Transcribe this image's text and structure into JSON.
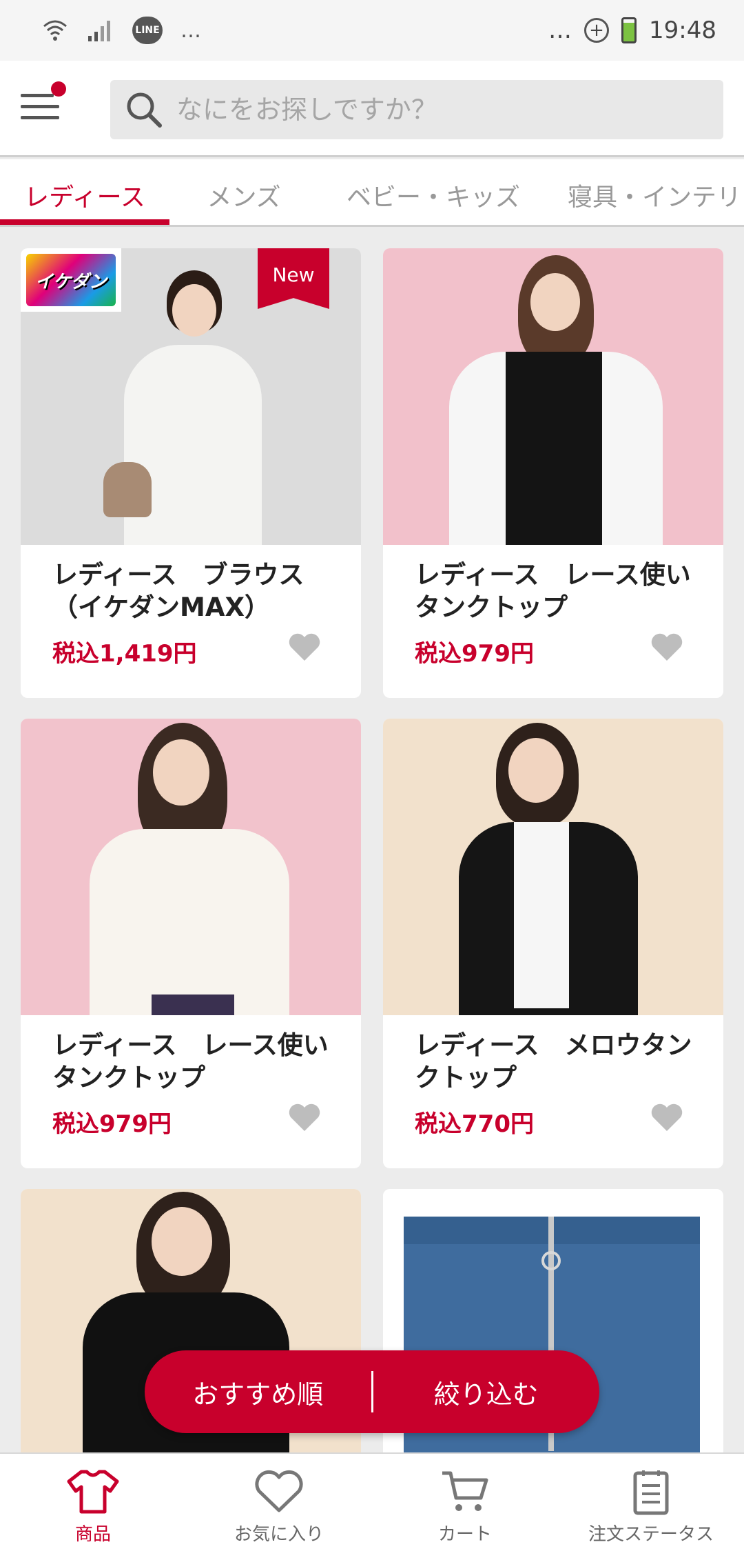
{
  "status_bar": {
    "time": "19:48",
    "left_icons": [
      "wifi-icon",
      "signal-icon",
      "line-app-icon",
      "more-icon"
    ],
    "line_label": "LINE",
    "more_left": "…",
    "more_right": "…"
  },
  "header": {
    "search_placeholder": "なにをお探しですか？"
  },
  "tabs": [
    {
      "label": "レディース",
      "active": true
    },
    {
      "label": "メンズ",
      "active": false
    },
    {
      "label": "ベビー・キッズ",
      "active": false
    },
    {
      "label": "寝具・インテリ",
      "active": false
    }
  ],
  "products": [
    {
      "title": "レディース　ブラウス（イケダンMAX）",
      "price": "税込1,419円",
      "badge": "New",
      "logo": "イケダン"
    },
    {
      "title": "レディース　レース使いタンクトップ",
      "price": "税込979円"
    },
    {
      "title": "レディース　レース使いタンクトップ",
      "price": "税込979円"
    },
    {
      "title": "レディース　メロウタンクトップ",
      "price": "税込770円"
    },
    {
      "title": "",
      "price": ""
    },
    {
      "title": "",
      "price": ""
    }
  ],
  "floating": {
    "sort_label": "おすすめ順",
    "filter_label": "絞り込む"
  },
  "bottom_nav": [
    {
      "label": "商品",
      "icon": "tshirt-icon",
      "active": true
    },
    {
      "label": "お気に入り",
      "icon": "heart-icon",
      "active": false
    },
    {
      "label": "カート",
      "icon": "cart-icon",
      "active": false
    },
    {
      "label": "注文ステータス",
      "icon": "order-list-icon",
      "active": false
    }
  ],
  "colors": {
    "accent": "#c8002c",
    "background": "#ececec"
  }
}
